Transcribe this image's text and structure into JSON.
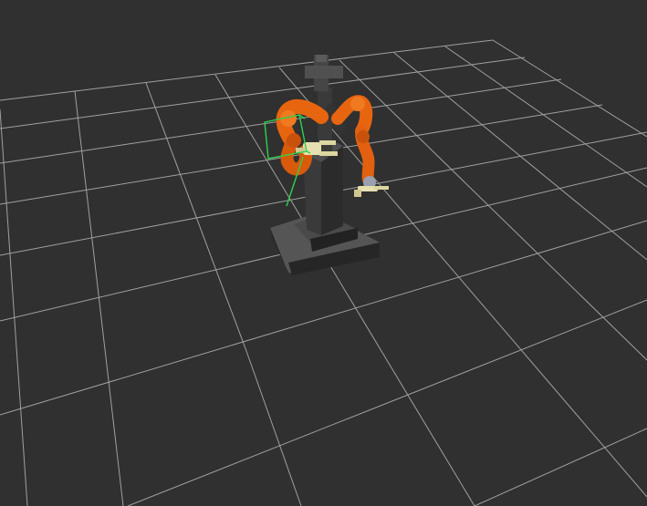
{
  "scene": {
    "background_color": "#303030",
    "grid_color": "#a0a0a0",
    "robot_color": "#e8650f",
    "pedestal_color": "#3c3c3c",
    "gripper_color": "#e6e0b0",
    "marker_color": "#2ed14a",
    "objects": [
      "floor-grid",
      "pedestal",
      "left-robot-arm",
      "right-robot-arm",
      "interactive-marker"
    ]
  }
}
